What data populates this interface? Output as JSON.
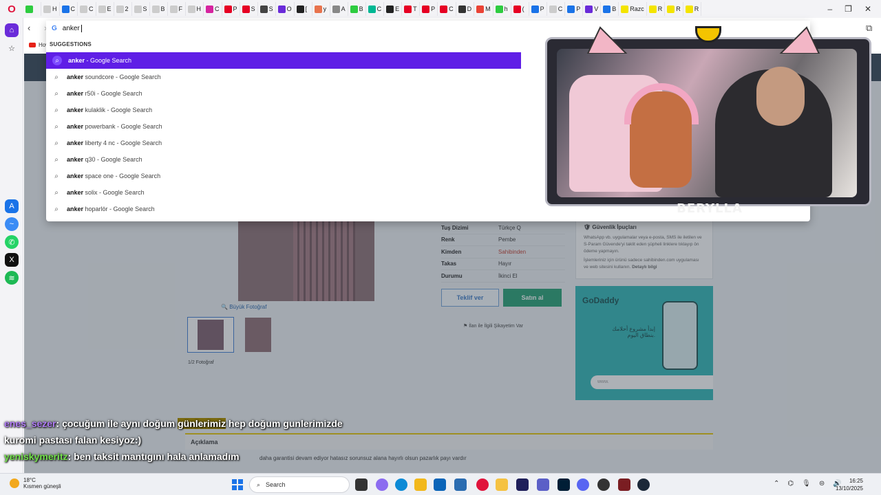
{
  "tabs": [
    {
      "label": "",
      "color": "#2ecc40"
    },
    {
      "label": "H",
      "color": "#cccccc"
    },
    {
      "label": "C",
      "color": "#1a73e8"
    },
    {
      "label": "C",
      "color": "#cccccc"
    },
    {
      "label": "E",
      "color": "#cccccc"
    },
    {
      "label": "2",
      "color": "#cccccc"
    },
    {
      "label": "S",
      "color": "#cccccc"
    },
    {
      "label": "B",
      "color": "#cccccc"
    },
    {
      "label": "F",
      "color": "#cccccc"
    },
    {
      "label": "H",
      "color": "#cccccc"
    },
    {
      "label": "C",
      "color": "#d6249f"
    },
    {
      "label": "P",
      "color": "#e60023"
    },
    {
      "label": "S",
      "color": "#e60023"
    },
    {
      "label": "S",
      "color": "#444444"
    },
    {
      "label": "O",
      "color": "#6a2bd9"
    },
    {
      "label": "[",
      "color": "#222222"
    },
    {
      "label": "y",
      "color": "#e8734d"
    },
    {
      "label": "A",
      "color": "#888888"
    },
    {
      "label": "B",
      "color": "#2ecc40"
    },
    {
      "label": "C",
      "color": "#00b894"
    },
    {
      "label": "E",
      "color": "#222222"
    },
    {
      "label": "T",
      "color": "#e60023"
    },
    {
      "label": "P",
      "color": "#e60023"
    },
    {
      "label": "C",
      "color": "#e60023"
    },
    {
      "label": "D",
      "color": "#333333"
    },
    {
      "label": "M",
      "color": "#ea4335"
    },
    {
      "label": "h",
      "color": "#2ecc40"
    },
    {
      "label": "(",
      "color": "#e60023"
    },
    {
      "label": "P",
      "color": "#1a73e8"
    },
    {
      "label": "C",
      "color": "#cccccc"
    },
    {
      "label": "P",
      "color": "#1a73e8"
    },
    {
      "label": "V",
      "color": "#6a2bd9"
    },
    {
      "label": "B",
      "color": "#1a73e8"
    },
    {
      "label": "Razc",
      "color": "#f4e400"
    },
    {
      "label": "R",
      "color": "#f4e400"
    },
    {
      "label": "R",
      "color": "#f4e400"
    },
    {
      "label": "R",
      "color": "#f4e400"
    }
  ],
  "address": {
    "typed": "anker",
    "suggestions_title": "SUGGESTIONS",
    "suggestions": [
      {
        "bold": "anker",
        "rest": " - Google Search"
      },
      {
        "bold": "anker",
        "rest": " soundcore - Google Search"
      },
      {
        "bold": "anker",
        "rest": " r50i - Google Search"
      },
      {
        "bold": "anker",
        "rest": " kulaklik - Google Search"
      },
      {
        "bold": "anker",
        "rest": " powerbank - Google Search"
      },
      {
        "bold": "anker",
        "rest": " liberty 4 nc - Google Search"
      },
      {
        "bold": "anker",
        "rest": " q30 - Google Search"
      },
      {
        "bold": "anker",
        "rest": " space one - Google Search"
      },
      {
        "bold": "anker",
        "rest": " solix - Google Search"
      },
      {
        "bold": "anker",
        "rest": " hoparlör - Google Search"
      }
    ]
  },
  "bookmarks": {
    "first": "How to Crea"
  },
  "listing": {
    "big_photo": "Büyük Fotoğraf",
    "photo_count": "1/2 Fotoğraf",
    "details": [
      {
        "k": "Tuş Dizimi",
        "v": "Türkçe Q",
        "red": false
      },
      {
        "k": "Renk",
        "v": "Pembe",
        "red": false
      },
      {
        "k": "Kimden",
        "v": "Sahibinden",
        "red": true
      },
      {
        "k": "Takas",
        "v": "Hayır",
        "red": false
      },
      {
        "k": "Durumu",
        "v": "İkinci El",
        "red": false
      }
    ],
    "offer_button": "Teklif ver",
    "buy_button": "Satın al",
    "report": "İlan ile İlgili Şikayetim Var",
    "safety_title": "Güvenlik İpuçları",
    "safety_text1": "WhatsApp vb. uygulamalar veya e-posta, SMS ile iletilen ve S-Param Güvende'yi taklit eden şüpheli linklere tıklayıp ön ödeme yapmayın.",
    "safety_text2": "İşlemleriniz için ürünü sadece sahibinden.com uygulaması ve web sitesini kullanın.",
    "safety_link": "Detaylı bilgi",
    "ad_brand": "GoDaddy",
    "ad_text": "إبدأ مشروع أحلامك بنطاق اليوم.",
    "ad_input": "www.",
    "desc_title": "Açıklama",
    "desc_text": "daha garantisi devam ediyor hatasız sorunsuz alana hayırlı olsun pazarlık payı vardır"
  },
  "stream": {
    "name": "BERYLLA",
    "chat": [
      {
        "user": "enes_sezer",
        "text": ": çocuğum ile aynı doğum ",
        "highlight": "günlerimiz",
        "text2": " hep doğum gunlerimizde"
      },
      {
        "user": "",
        "text": "kuromi pastası falan kesiyoz:)",
        "highlight": "",
        "text2": ""
      },
      {
        "user": "yeniskymeritz",
        "text": ": ben taksit mantıgını hala anlamadım",
        "highlight": "",
        "text2": ""
      }
    ]
  },
  "taskbar": {
    "temp": "18°C",
    "weather": "Kısmen güneşli",
    "search": "Search",
    "time": "16:25",
    "date": "13/10/2025"
  },
  "colors": {
    "accent": "#5f1ee6",
    "opera_red": "#e0143c",
    "buy_green": "#1f9f71"
  }
}
